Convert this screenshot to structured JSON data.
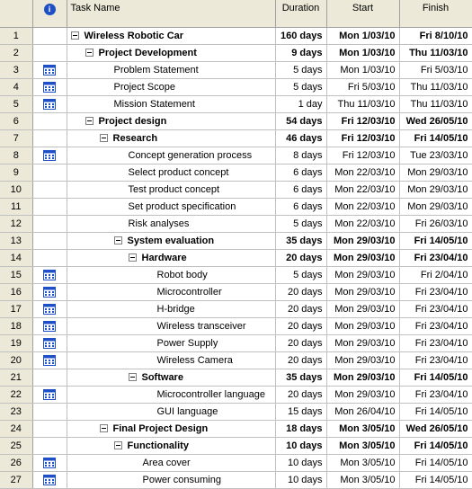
{
  "columns": {
    "id": "",
    "indicator_icon": "info-icon",
    "name": "Task Name",
    "duration": "Duration",
    "start": "Start",
    "finish": "Finish"
  },
  "tasks": [
    {
      "id": "1",
      "name": "Wireless Robotic Car",
      "duration": "160 days",
      "start": "Mon 1/03/10",
      "finish": "Fri 8/10/10",
      "level": 1,
      "summary": true,
      "indicator": ""
    },
    {
      "id": "2",
      "name": "Project  Development",
      "duration": "9 days",
      "start": "Mon 1/03/10",
      "finish": "Thu 11/03/10",
      "level": 2,
      "summary": true,
      "indicator": ""
    },
    {
      "id": "3",
      "name": "Problem Statement",
      "duration": "5 days",
      "start": "Mon 1/03/10",
      "finish": "Fri 5/03/10",
      "level": 3,
      "summary": false,
      "indicator": "calendar-icon"
    },
    {
      "id": "4",
      "name": "Project Scope",
      "duration": "5 days",
      "start": "Fri 5/03/10",
      "finish": "Thu 11/03/10",
      "level": 3,
      "summary": false,
      "indicator": "calendar-icon"
    },
    {
      "id": "5",
      "name": "Mission Statement",
      "duration": "1 day",
      "start": "Thu 11/03/10",
      "finish": "Thu 11/03/10",
      "level": 3,
      "summary": false,
      "indicator": "calendar-icon"
    },
    {
      "id": "6",
      "name": "Project design",
      "duration": "54 days",
      "start": "Fri 12/03/10",
      "finish": "Wed 26/05/10",
      "level": 2,
      "summary": true,
      "indicator": ""
    },
    {
      "id": "7",
      "name": "Research",
      "duration": "46 days",
      "start": "Fri 12/03/10",
      "finish": "Fri 14/05/10",
      "level": 3,
      "summary": true,
      "indicator": ""
    },
    {
      "id": "8",
      "name": "Concept generation process",
      "duration": "8 days",
      "start": "Fri 12/03/10",
      "finish": "Tue 23/03/10",
      "level": 4,
      "summary": false,
      "indicator": "calendar-icon"
    },
    {
      "id": "9",
      "name": "Select product concept",
      "duration": "6 days",
      "start": "Mon 22/03/10",
      "finish": "Mon 29/03/10",
      "level": 4,
      "summary": false,
      "indicator": ""
    },
    {
      "id": "10",
      "name": "Test product concept",
      "duration": "6 days",
      "start": "Mon 22/03/10",
      "finish": "Mon 29/03/10",
      "level": 4,
      "summary": false,
      "indicator": ""
    },
    {
      "id": "11",
      "name": "Set product specification",
      "duration": "6 days",
      "start": "Mon 22/03/10",
      "finish": "Mon 29/03/10",
      "level": 4,
      "summary": false,
      "indicator": ""
    },
    {
      "id": "12",
      "name": "Risk analyses",
      "duration": "5 days",
      "start": "Mon 22/03/10",
      "finish": "Fri 26/03/10",
      "level": 4,
      "summary": false,
      "indicator": ""
    },
    {
      "id": "13",
      "name": "System evaluation",
      "duration": "35 days",
      "start": "Mon 29/03/10",
      "finish": "Fri 14/05/10",
      "level": 4,
      "summary": true,
      "indicator": ""
    },
    {
      "id": "14",
      "name": "Hardware",
      "duration": "20 days",
      "start": "Mon 29/03/10",
      "finish": "Fri 23/04/10",
      "level": 5,
      "summary": true,
      "indicator": ""
    },
    {
      "id": "15",
      "name": "Robot body",
      "duration": "5 days",
      "start": "Mon 29/03/10",
      "finish": "Fri 2/04/10",
      "level": 6,
      "summary": false,
      "indicator": "calendar-icon"
    },
    {
      "id": "16",
      "name": "Microcontroller",
      "duration": "20 days",
      "start": "Mon 29/03/10",
      "finish": "Fri 23/04/10",
      "level": 6,
      "summary": false,
      "indicator": "calendar-icon"
    },
    {
      "id": "17",
      "name": "H-bridge",
      "duration": "20 days",
      "start": "Mon 29/03/10",
      "finish": "Fri 23/04/10",
      "level": 6,
      "summary": false,
      "indicator": "calendar-icon"
    },
    {
      "id": "18",
      "name": "Wireless transceiver",
      "duration": "20 days",
      "start": "Mon 29/03/10",
      "finish": "Fri 23/04/10",
      "level": 6,
      "summary": false,
      "indicator": "calendar-icon"
    },
    {
      "id": "19",
      "name": "Power Supply",
      "duration": "20 days",
      "start": "Mon 29/03/10",
      "finish": "Fri 23/04/10",
      "level": 6,
      "summary": false,
      "indicator": "calendar-icon"
    },
    {
      "id": "20",
      "name": "Wireless Camera",
      "duration": "20 days",
      "start": "Mon 29/03/10",
      "finish": "Fri 23/04/10",
      "level": 6,
      "summary": false,
      "indicator": "calendar-icon"
    },
    {
      "id": "21",
      "name": "Software",
      "duration": "35 days",
      "start": "Mon 29/03/10",
      "finish": "Fri 14/05/10",
      "level": 5,
      "summary": true,
      "indicator": ""
    },
    {
      "id": "22",
      "name": "Microcontroller language",
      "duration": "20 days",
      "start": "Mon 29/03/10",
      "finish": "Fri 23/04/10",
      "level": 6,
      "summary": false,
      "indicator": "calendar-icon"
    },
    {
      "id": "23",
      "name": "GUI language",
      "duration": "15 days",
      "start": "Mon 26/04/10",
      "finish": "Fri 14/05/10",
      "level": 6,
      "summary": false,
      "indicator": ""
    },
    {
      "id": "24",
      "name": "Final Project Design",
      "duration": "18 days",
      "start": "Mon 3/05/10",
      "finish": "Wed 26/05/10",
      "level": 3,
      "summary": true,
      "indicator": ""
    },
    {
      "id": "25",
      "name": "Functionality",
      "duration": "10 days",
      "start": "Mon 3/05/10",
      "finish": "Fri 14/05/10",
      "level": 4,
      "summary": true,
      "indicator": ""
    },
    {
      "id": "26",
      "name": "Area cover",
      "duration": "10 days",
      "start": "Mon 3/05/10",
      "finish": "Fri 14/05/10",
      "level": 5,
      "summary": false,
      "indicator": "calendar-icon"
    },
    {
      "id": "27",
      "name": "Power consuming",
      "duration": "10 days",
      "start": "Mon 3/05/10",
      "finish": "Fri 14/05/10",
      "level": 5,
      "summary": false,
      "indicator": "calendar-icon"
    }
  ],
  "colors": {
    "header_bg": "#ece9d8",
    "grid_line": "#c0c0c0",
    "info_icon": "#1f4fc4",
    "calendar_icon": "#1f4fc4"
  }
}
